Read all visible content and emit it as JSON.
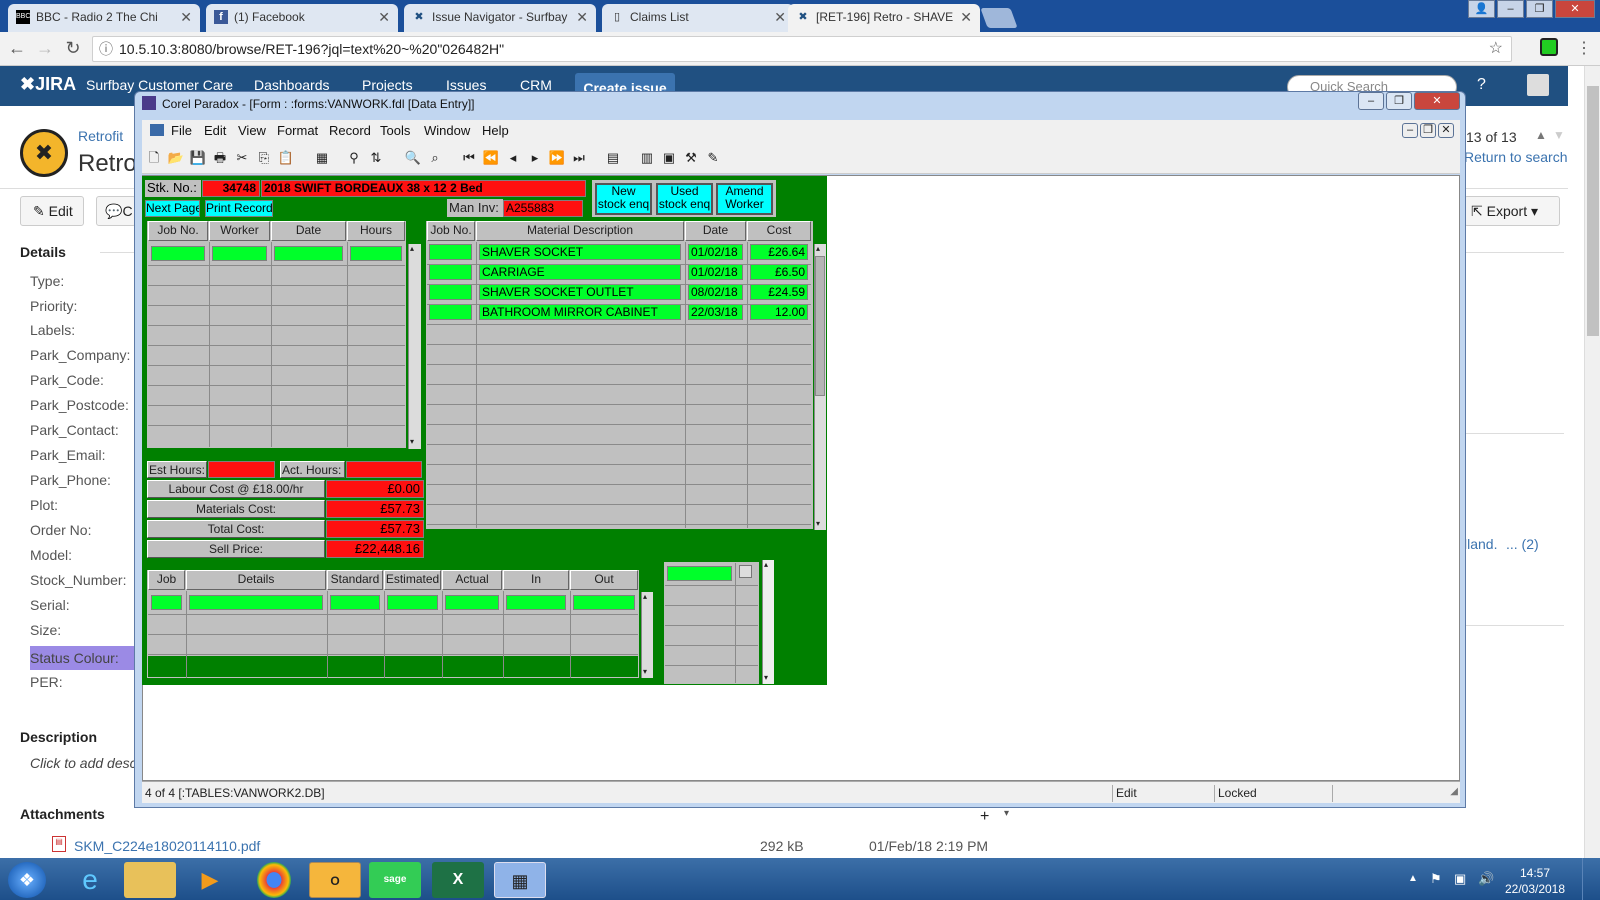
{
  "browser": {
    "tabs": [
      {
        "label": "BBC - Radio 2 The Chi",
        "icon": "bbc-icon"
      },
      {
        "label": "(1) Facebook",
        "icon": "facebook-icon"
      },
      {
        "label": "Issue Navigator - Surfbay",
        "icon": "jira-icon"
      },
      {
        "label": "Claims List",
        "icon": "page-icon"
      },
      {
        "label": "[RET-196] Retro - SHAVE",
        "icon": "jira-icon"
      }
    ],
    "url": "10.5.10.3:8080/browse/RET-196?jql=text%20~%20\"026482H\""
  },
  "jira": {
    "logo": "JIRA",
    "nav": [
      "Surfbay Customer Care",
      "Dashboards",
      "Projects",
      "Issues",
      "CRM"
    ],
    "create": "Create issue",
    "search_placeholder": "Quick Search",
    "breadcrumb": "Retrofit",
    "issue_title": "Retro",
    "counter": "13 of 13",
    "return": "Return to search",
    "edit": "Edit",
    "comment": "C",
    "export": "Export",
    "details_heading": "Details",
    "fields": [
      "Type:",
      "Priority:",
      "Labels:",
      "Park_Company:",
      "Park_Code:",
      "Park_Postcode:",
      "Park_Contact:",
      "Park_Email:",
      "Park_Phone:",
      "Plot:",
      "Order No:",
      "Model:",
      "Stock_Number:",
      "Serial:",
      "Size:",
      "Status Colour:",
      "PER:"
    ],
    "right_text": "lland.",
    "right_link": "... (2)",
    "description_heading": "Description",
    "description_placeholder": "Click to add desc",
    "attachments_heading": "Attachments",
    "attachment": {
      "name": "SKM_C224e18020114110.pdf",
      "size": "292 kB",
      "date": "01/Feb/18 2:19 PM"
    }
  },
  "paradox": {
    "title": "Corel Paradox - [Form : :forms:VANWORK.fdl [Data Entry]]",
    "menu": [
      "File",
      "Edit",
      "View",
      "Format",
      "Record",
      "Tools",
      "Window",
      "Help"
    ],
    "status_left": "4 of 4 [:TABLES:VANWORK2.DB]",
    "status_mode": "Edit",
    "status_lock": "Locked"
  },
  "form": {
    "stk_label": "Stk. No.:",
    "stk_no": "34748",
    "stk_desc": "2018 SWIFT BORDEAUX 38 x 12 2 Bed",
    "next_page": "Next Page",
    "print_record": "Print Record",
    "man_inv_label": "Man Inv:",
    "man_inv": "A255883",
    "btn_new": [
      "New",
      "stock enq"
    ],
    "btn_used": [
      "Used",
      "stock enq"
    ],
    "btn_amend": [
      "Amend",
      "Worker"
    ],
    "labour_headers": [
      "Job No.",
      "Worker",
      "Date",
      "Hours"
    ],
    "material_headers": [
      "Job No.",
      "Material Description",
      "Date",
      "Cost"
    ],
    "materials": [
      {
        "job": "",
        "desc": "SHAVER SOCKET",
        "date": "01/02/18",
        "cost": "£26.64"
      },
      {
        "job": "",
        "desc": "CARRIAGE",
        "date": "01/02/18",
        "cost": "£6.50"
      },
      {
        "job": "",
        "desc": "SHAVER SOCKET OUTLET",
        "date": "08/02/18",
        "cost": "£24.59"
      },
      {
        "job": "",
        "desc": "BATHROOM MIRROR CABINET",
        "date": "22/03/18",
        "cost": "12.00"
      }
    ],
    "est_hours_label": "Est Hours:",
    "act_hours_label": "Act. Hours:",
    "totals": [
      {
        "label": "Labour Cost @ £18.00/hr",
        "value": "£0.00"
      },
      {
        "label": "Materials Cost:",
        "value": "£57.73"
      },
      {
        "label": "Total Cost:",
        "value": "£57.73"
      },
      {
        "label": "Sell Price:",
        "value": "£22,448.16"
      }
    ],
    "job_headers": [
      "Job",
      "Details",
      "Standard",
      "Estimated",
      "Actual",
      "In",
      "Out"
    ]
  },
  "taskbar": {
    "time": "14:57",
    "date": "22/03/2018"
  }
}
